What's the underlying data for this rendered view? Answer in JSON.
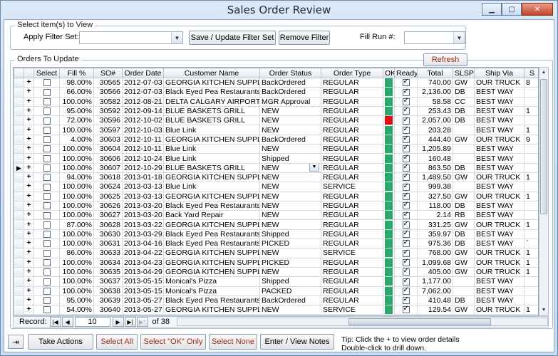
{
  "window": {
    "title": "Sales Order Review",
    "minimize": "▁",
    "maximize": "▢",
    "close": "✕"
  },
  "filter": {
    "group_label": "Select item(s) to View",
    "apply_label": "Apply Filter Set:",
    "save_button": "Save / Update Filter Set",
    "remove_button": "Remove Filter",
    "fill_run_label": "Fill Run #:"
  },
  "orders": {
    "group_label": "Orders To Update",
    "refresh_button": "Refresh",
    "columns": [
      "",
      "Select",
      "Fill %",
      "SO#",
      "Order Date",
      "Customer Name",
      "Order Status",
      "Order Type",
      "OK",
      "Ready",
      "Total",
      "SLSP",
      "Ship Via",
      "S"
    ],
    "rows": [
      {
        "fill": "98.00%",
        "so": "30565",
        "date": "2012-07-03",
        "cust": "GEORGIA KITCHEN SUPPLIES",
        "status": "BackOrdered",
        "type": "REGULAR",
        "ok": "#2aa86a",
        "total": "740.00",
        "slsp": "GW",
        "ship": "OUR TRUCK",
        "extra": "8"
      },
      {
        "fill": "66.00%",
        "so": "30566",
        "date": "2012-07-03",
        "cust": "Black Eyed Pea Restaurants",
        "status": "BackOrdered",
        "type": "REGULAR",
        "ok": "#2aa86a",
        "total": "2,136.00",
        "slsp": "DB",
        "ship": "BEST WAY",
        "extra": ""
      },
      {
        "fill": "100.00%",
        "so": "30582",
        "date": "2012-08-21",
        "cust": "DELTA CALGARY AIRPORT",
        "status": "MGR Approval",
        "type": "REGULAR",
        "ok": "#2aa86a",
        "total": "58.58",
        "slsp": "CC",
        "ship": "BEST WAY",
        "extra": ""
      },
      {
        "fill": "95.00%",
        "so": "30592",
        "date": "2012-09-14",
        "cust": "BLUE BASKETS GRILL",
        "status": "NEW",
        "type": "REGULAR",
        "ok": "#2aa86a",
        "total": "253.43",
        "slsp": "DB",
        "ship": "BEST WAY",
        "extra": "1"
      },
      {
        "fill": "72.00%",
        "so": "30596",
        "date": "2012-10-02",
        "cust": "BLUE BASKETS GRILL",
        "status": "NEW",
        "type": "REGULAR",
        "ok": "#e01010",
        "total": "2,057.00",
        "slsp": "DB",
        "ship": "BEST WAY",
        "extra": ""
      },
      {
        "fill": "100.00%",
        "so": "30597",
        "date": "2012-10-03",
        "cust": "Blue Link",
        "status": "NEW",
        "type": "REGULAR",
        "ok": "#2aa86a",
        "total": "203.28",
        "slsp": "",
        "ship": "BEST WAY",
        "extra": "1"
      },
      {
        "fill": "4.00%",
        "so": "30603",
        "date": "2012-10-11",
        "cust": "GEORGIA KITCHEN SUPPLIES",
        "status": "BackOrdered",
        "type": "REGULAR",
        "ok": "#2aa86a",
        "total": "444.40",
        "slsp": "GW",
        "ship": "OUR TRUCK",
        "extra": "9"
      },
      {
        "fill": "100.00%",
        "so": "30604",
        "date": "2012-10-11",
        "cust": "Blue Link",
        "status": "NEW",
        "type": "REGULAR",
        "ok": "#2aa86a",
        "total": "1,205.89",
        "slsp": "",
        "ship": "BEST WAY",
        "extra": ""
      },
      {
        "fill": "100.00%",
        "so": "30606",
        "date": "2012-10-24",
        "cust": "Blue Link",
        "status": "Shipped",
        "type": "REGULAR",
        "ok": "#2aa86a",
        "total": "160.48",
        "slsp": "",
        "ship": "BEST WAY",
        "extra": ""
      },
      {
        "fill": "100.00%",
        "so": "30607",
        "date": "2012-10-29",
        "cust": "BLUE BASKETS GRILL",
        "status": "NEW",
        "type": "REGULAR",
        "ok": "#2aa86a",
        "total": "863.50",
        "slsp": "DB",
        "ship": "BEST WAY",
        "extra": "",
        "current": true
      },
      {
        "fill": "94.00%",
        "so": "30618",
        "date": "2013-01-18",
        "cust": "GEORGIA KITCHEN SUPPLIES",
        "status": "NEW",
        "type": "REGULAR",
        "ok": "#2aa86a",
        "total": "1,489.50",
        "slsp": "GW",
        "ship": "OUR TRUCK",
        "extra": "1"
      },
      {
        "fill": "100.00%",
        "so": "30624",
        "date": "2013-03-13",
        "cust": "Blue Link",
        "status": "NEW",
        "type": "SERVICE",
        "ok": "#2aa86a",
        "total": "999.38",
        "slsp": "",
        "ship": "BEST WAY",
        "extra": ""
      },
      {
        "fill": "100.00%",
        "so": "30625",
        "date": "2013-03-13",
        "cust": "GEORGIA KITCHEN SUPPLIES",
        "status": "NEW",
        "type": "REGULAR",
        "ok": "#2aa86a",
        "total": "327.50",
        "slsp": "GW",
        "ship": "OUR TRUCK",
        "extra": "1"
      },
      {
        "fill": "100.00%",
        "so": "30626",
        "date": "2013-03-20",
        "cust": "Black Eyed Pea Restaurants",
        "status": "NEW",
        "type": "REGULAR",
        "ok": "#2aa86a",
        "total": "118.00",
        "slsp": "DB",
        "ship": "BEST WAY",
        "extra": ""
      },
      {
        "fill": "100.00%",
        "so": "30627",
        "date": "2013-03-20",
        "cust": "Back Yard Repair",
        "status": "NEW",
        "type": "REGULAR",
        "ok": "#2aa86a",
        "total": "2.14",
        "slsp": "RB",
        "ship": "BEST WAY",
        "extra": ""
      },
      {
        "fill": "87.00%",
        "so": "30628",
        "date": "2013-03-22",
        "cust": "GEORGIA KITCHEN SUPPLIES",
        "status": "NEW",
        "type": "REGULAR",
        "ok": "#2aa86a",
        "total": "331.25",
        "slsp": "GW",
        "ship": "OUR TRUCK",
        "extra": "1"
      },
      {
        "fill": "100.00%",
        "so": "30630",
        "date": "2013-03-29",
        "cust": "Black Eyed Pea Restaurants",
        "status": "Shipped",
        "type": "REGULAR",
        "ok": "#2aa86a",
        "total": "359.97",
        "slsp": "DB",
        "ship": "BEST WAY",
        "extra": ""
      },
      {
        "fill": "100.00%",
        "so": "30631",
        "date": "2013-04-16",
        "cust": "Black Eyed Pea Restaurants",
        "status": "PICKED",
        "type": "REGULAR",
        "ok": "#2aa86a",
        "total": "975.36",
        "slsp": "DB",
        "ship": "BEST WAY",
        "extra": "`"
      },
      {
        "fill": "86.00%",
        "so": "30633",
        "date": "2013-04-22",
        "cust": "GEORGIA KITCHEN SUPPLIES",
        "status": "NEW",
        "type": "SERVICE",
        "ok": "#2aa86a",
        "total": "768.00",
        "slsp": "GW",
        "ship": "OUR TRUCK",
        "extra": "1"
      },
      {
        "fill": "100.00%",
        "so": "30634",
        "date": "2013-04-23",
        "cust": "GEORGIA KITCHEN SUPPLIES",
        "status": "PICKED",
        "type": "REGULAR",
        "ok": "#2aa86a",
        "total": "1,099.68",
        "slsp": "GW",
        "ship": "OUR TRUCK",
        "extra": "1"
      },
      {
        "fill": "100.00%",
        "so": "30635",
        "date": "2013-04-29",
        "cust": "GEORGIA KITCHEN SUPPLIES",
        "status": "NEW",
        "type": "REGULAR",
        "ok": "#2aa86a",
        "total": "405.00",
        "slsp": "GW",
        "ship": "OUR TRUCK",
        "extra": "1"
      },
      {
        "fill": "100.00%",
        "so": "30637",
        "date": "2013-05-15",
        "cust": "Monical's Pizza",
        "status": "Shipped",
        "type": "REGULAR",
        "ok": "#2aa86a",
        "total": "1,177.00",
        "slsp": "",
        "ship": "BEST WAY",
        "extra": ""
      },
      {
        "fill": "100.00%",
        "so": "30638",
        "date": "2013-05-15",
        "cust": "Monical's Pizza",
        "status": "PACKED",
        "type": "REGULAR",
        "ok": "#2aa86a",
        "total": "7,062.00",
        "slsp": "",
        "ship": "BEST WAY",
        "extra": ""
      },
      {
        "fill": "95.00%",
        "so": "30639",
        "date": "2013-05-27",
        "cust": "Black Eyed Pea Restaurants",
        "status": "BackOrdered",
        "type": "REGULAR",
        "ok": "#2aa86a",
        "total": "410.48",
        "slsp": "DB",
        "ship": "BEST WAY",
        "extra": ""
      },
      {
        "fill": "54.00%",
        "so": "30640",
        "date": "2013-05-27",
        "cust": "GEORGIA KITCHEN SUPPLIES",
        "status": "NEW",
        "type": "SERVICE",
        "ok": "#2aa86a",
        "total": "129.54",
        "slsp": "GW",
        "ship": "OUR TRUCK",
        "extra": "1"
      }
    ]
  },
  "navigator": {
    "label": "Record:",
    "current": "10",
    "of_label": "of 38"
  },
  "bottom": {
    "take_actions": "Take Actions",
    "select_all": "Select All",
    "select_ok_only": "Select \"OK\" Only",
    "select_none": "Select None",
    "enter_view_notes": "Enter / View Notes",
    "tip_line1": "Tip: Click the + to view order details",
    "tip_line2": "Double-click to drill down."
  },
  "icons": {
    "exit": "exit-door-icon",
    "row_selector": "row-pointer-icon"
  }
}
